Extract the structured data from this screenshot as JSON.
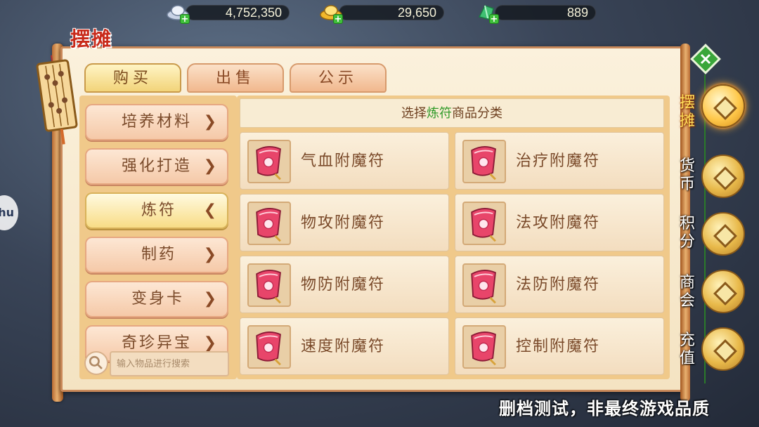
{
  "currency": {
    "silver": "4,752,350",
    "gold": "29,650",
    "jade": "889"
  },
  "stall_title": "摆摊",
  "tabs": [
    "购买",
    "出售",
    "公示"
  ],
  "categories": [
    {
      "label": "培养材料",
      "arrow": "❯"
    },
    {
      "label": "强化打造",
      "arrow": "❯"
    },
    {
      "label": "炼符",
      "arrow": "❮"
    },
    {
      "label": "制药",
      "arrow": "❯"
    },
    {
      "label": "变身卡",
      "arrow": "❯"
    },
    {
      "label": "奇珍异宝",
      "arrow": "❯"
    }
  ],
  "search": {
    "placeholder": "输入物品进行搜索"
  },
  "header": {
    "prefix": "选择",
    "highlight": "炼符",
    "suffix": "商品分类"
  },
  "items": [
    "气血附魔符",
    "治疗附魔符",
    "物攻附魔符",
    "法攻附魔符",
    "物防附魔符",
    "法防附魔符",
    "速度附魔符",
    "控制附魔符"
  ],
  "sidenav": [
    {
      "label_top": "摆",
      "label_bottom": "摊"
    },
    {
      "label_top": "货",
      "label_bottom": "币"
    },
    {
      "label_top": "积",
      "label_bottom": "分"
    },
    {
      "label_top": "商",
      "label_bottom": "会"
    },
    {
      "label_top": "充",
      "label_bottom": "值"
    }
  ],
  "bubble_text": "hu",
  "disclaimer": "删档测试，非最终游戏品质",
  "colors": {
    "highlight": "#2f9a28",
    "accent": "#c82a1a"
  }
}
